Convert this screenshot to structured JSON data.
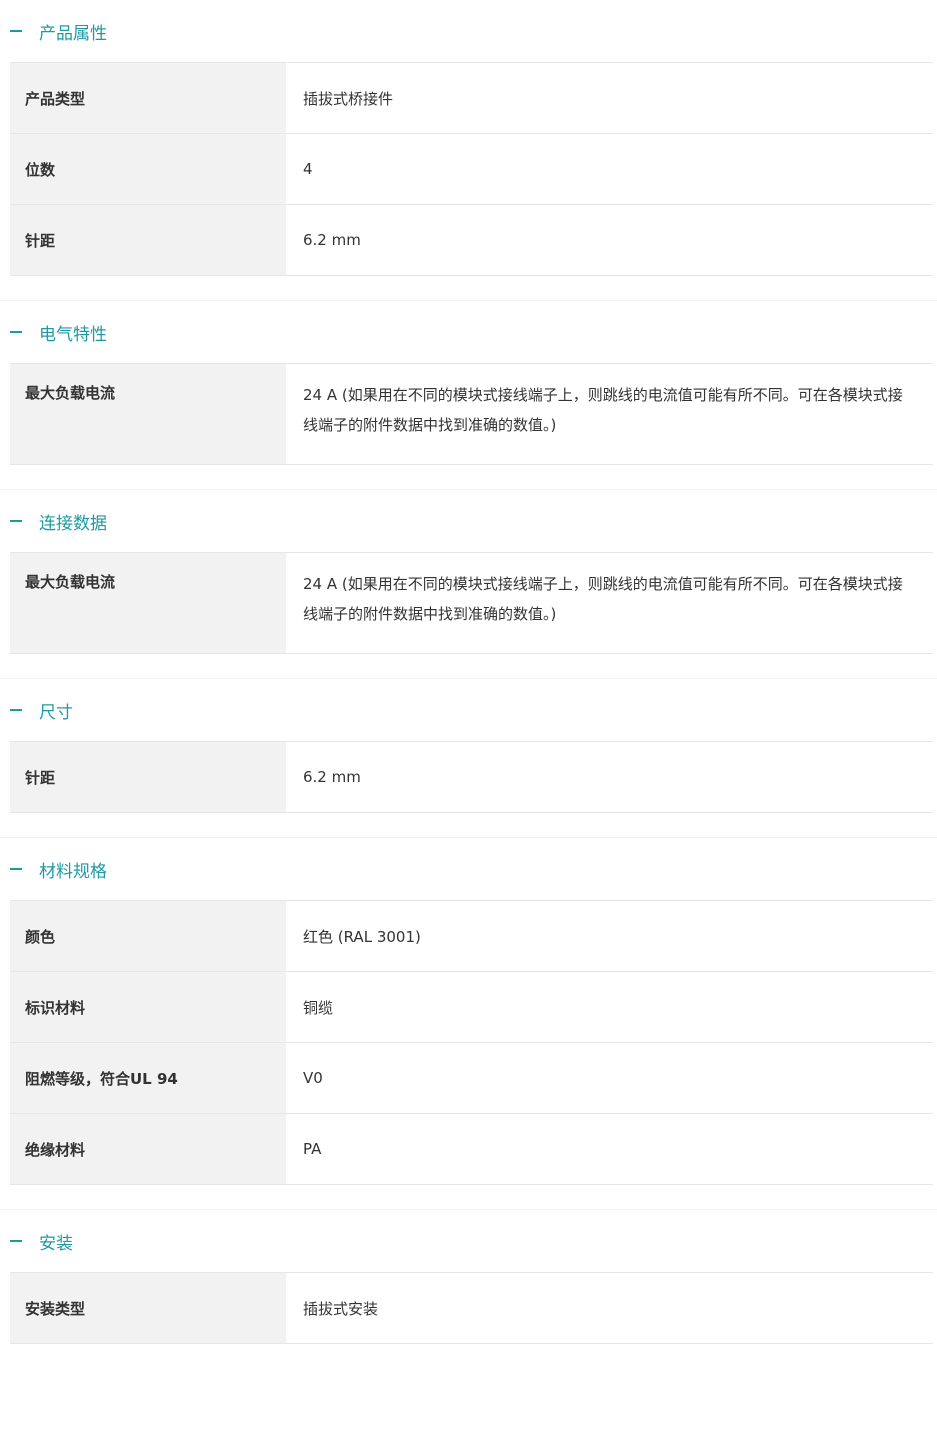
{
  "accent_color": "#1e9aa4",
  "sections": [
    {
      "title": "产品属性",
      "rows": [
        {
          "label": "产品类型",
          "value": "插拔式桥接件"
        },
        {
          "label": "位数",
          "value": "4"
        },
        {
          "label": "针距",
          "value": "6.2 mm"
        }
      ]
    },
    {
      "title": "电气特性",
      "rows": [
        {
          "label": "最大负载电流",
          "value": "24 A (如果用在不同的模块式接线端子上，则跳线的电流值可能有所不同。可在各模块式接线端子的附件数据中找到准确的数值。)"
        }
      ]
    },
    {
      "title": "连接数据",
      "rows": [
        {
          "label": "最大负载电流",
          "value": "24 A (如果用在不同的模块式接线端子上，则跳线的电流值可能有所不同。可在各模块式接线端子的附件数据中找到准确的数值。)"
        }
      ]
    },
    {
      "title": "尺寸",
      "rows": [
        {
          "label": "针距",
          "value": "6.2 mm"
        }
      ]
    },
    {
      "title": "材料规格",
      "rows": [
        {
          "label": "颜色",
          "value": "红色 (RAL 3001)"
        },
        {
          "label": "标识材料",
          "value": "铜缆"
        },
        {
          "label": "阻燃等级，符合UL 94",
          "value": "V0"
        },
        {
          "label": "绝缘材料",
          "value": "PA"
        }
      ]
    },
    {
      "title": "安装",
      "rows": [
        {
          "label": "安装类型",
          "value": "插拔式安装"
        }
      ]
    }
  ]
}
